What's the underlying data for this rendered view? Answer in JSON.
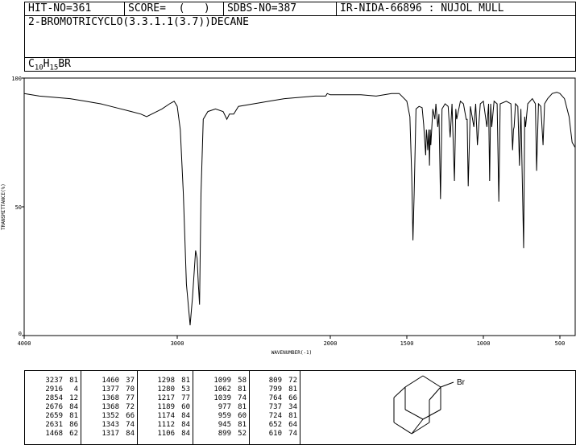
{
  "header": {
    "hit_no": "HIT-NO=361",
    "score": "SCORE=  (   )",
    "sdbs_no": "SDBS-NO=387",
    "ir_id": "IR-NIDA-66896 : NUJOL MULL",
    "compound_name": "2-BROMOTRICYCLO(3.3.1.1(3.7))DECANE",
    "formula_c": "C",
    "formula_c_sub": "10",
    "formula_h": "H",
    "formula_h_sub": "15",
    "formula_br": "BR"
  },
  "structure": {
    "atom_label": "Br"
  },
  "chart_data": {
    "type": "line",
    "xlabel": "WAVENUMBER(-1)",
    "ylabel": "TRANSMITTANCE(%)",
    "xlim": [
      4000,
      400
    ],
    "ylim": [
      0,
      100
    ],
    "x_ticks": [
      4000,
      3000,
      2000,
      1500,
      1000,
      500
    ],
    "y_ticks": [
      0,
      50,
      100
    ],
    "x_tick_labels": [
      "4000",
      "3000",
      "2000",
      "1500",
      "1000",
      "500"
    ],
    "y_tick_labels": [
      "0",
      "50",
      "100"
    ],
    "series": [
      {
        "values": [
          [
            4000,
            94
          ],
          [
            3900,
            93
          ],
          [
            3800,
            92.5
          ],
          [
            3700,
            92
          ],
          [
            3600,
            91
          ],
          [
            3500,
            90
          ],
          [
            3400,
            88.5
          ],
          [
            3300,
            87
          ],
          [
            3237,
            86
          ],
          [
            3200,
            85
          ],
          [
            3150,
            86.5
          ],
          [
            3100,
            88
          ],
          [
            3050,
            90
          ],
          [
            3020,
            91
          ],
          [
            3000,
            89
          ],
          [
            2980,
            80
          ],
          [
            2960,
            55
          ],
          [
            2940,
            20
          ],
          [
            2916,
            4
          ],
          [
            2900,
            15
          ],
          [
            2880,
            33
          ],
          [
            2870,
            30
          ],
          [
            2862,
            20
          ],
          [
            2854,
            12
          ],
          [
            2845,
            55
          ],
          [
            2830,
            84
          ],
          [
            2800,
            87
          ],
          [
            2750,
            88
          ],
          [
            2700,
            87
          ],
          [
            2676,
            84
          ],
          [
            2659,
            86
          ],
          [
            2631,
            86
          ],
          [
            2600,
            89
          ],
          [
            2500,
            90
          ],
          [
            2400,
            91
          ],
          [
            2300,
            92
          ],
          [
            2200,
            92.5
          ],
          [
            2100,
            93
          ],
          [
            2030,
            93
          ],
          [
            2020,
            94
          ],
          [
            2000,
            93.5
          ],
          [
            1900,
            93.5
          ],
          [
            1800,
            93.5
          ],
          [
            1700,
            93
          ],
          [
            1600,
            94
          ],
          [
            1550,
            94
          ],
          [
            1500,
            91
          ],
          [
            1480,
            85
          ],
          [
            1468,
            62
          ],
          [
            1460,
            37
          ],
          [
            1452,
            55
          ],
          [
            1440,
            88
          ],
          [
            1420,
            89
          ],
          [
            1400,
            88.5
          ],
          [
            1390,
            82
          ],
          [
            1377,
            70
          ],
          [
            1372,
            80
          ],
          [
            1368,
            77
          ],
          [
            1363,
            72
          ],
          [
            1356,
            80
          ],
          [
            1352,
            66
          ],
          [
            1347,
            80
          ],
          [
            1343,
            74
          ],
          [
            1330,
            88
          ],
          [
            1317,
            84
          ],
          [
            1310,
            90
          ],
          [
            1298,
            81
          ],
          [
            1290,
            86
          ],
          [
            1280,
            53
          ],
          [
            1270,
            88
          ],
          [
            1250,
            90
          ],
          [
            1230,
            89
          ],
          [
            1217,
            77
          ],
          [
            1205,
            90
          ],
          [
            1189,
            60
          ],
          [
            1180,
            88
          ],
          [
            1174,
            84
          ],
          [
            1150,
            91
          ],
          [
            1130,
            90
          ],
          [
            1112,
            84
          ],
          [
            1106,
            84
          ],
          [
            1099,
            58
          ],
          [
            1085,
            89
          ],
          [
            1062,
            81
          ],
          [
            1050,
            90
          ],
          [
            1039,
            74
          ],
          [
            1020,
            90
          ],
          [
            1000,
            91
          ],
          [
            977,
            81
          ],
          [
            966,
            90
          ],
          [
            959,
            60
          ],
          [
            952,
            90
          ],
          [
            945,
            81
          ],
          [
            930,
            91
          ],
          [
            910,
            90
          ],
          [
            899,
            52
          ],
          [
            890,
            90
          ],
          [
            850,
            91
          ],
          [
            820,
            90
          ],
          [
            809,
            72
          ],
          [
            803,
            80
          ],
          [
            799,
            81
          ],
          [
            790,
            90
          ],
          [
            775,
            89
          ],
          [
            764,
            66
          ],
          [
            755,
            88
          ],
          [
            737,
            34
          ],
          [
            730,
            85
          ],
          [
            724,
            81
          ],
          [
            710,
            90
          ],
          [
            680,
            92
          ],
          [
            660,
            90
          ],
          [
            652,
            64
          ],
          [
            640,
            90
          ],
          [
            625,
            89
          ],
          [
            610,
            74
          ],
          [
            600,
            90
          ],
          [
            580,
            92
          ],
          [
            550,
            94
          ],
          [
            520,
            94.5
          ],
          [
            500,
            94
          ],
          [
            470,
            92
          ],
          [
            440,
            85
          ],
          [
            420,
            75
          ],
          [
            400,
            73
          ]
        ]
      }
    ]
  },
  "peak_table": [
    [
      [
        "3237",
        "81"
      ],
      [
        "2916",
        "4"
      ],
      [
        "2854",
        "12"
      ],
      [
        "2676",
        "84"
      ],
      [
        "2659",
        "81"
      ],
      [
        "2631",
        "86"
      ],
      [
        "1468",
        "62"
      ]
    ],
    [
      [
        "1460",
        "37"
      ],
      [
        "1377",
        "70"
      ],
      [
        "1368",
        "77"
      ],
      [
        "1368",
        "72"
      ],
      [
        "1352",
        "66"
      ],
      [
        "1343",
        "74"
      ],
      [
        "1317",
        "84"
      ]
    ],
    [
      [
        "1298",
        "81"
      ],
      [
        "1280",
        "53"
      ],
      [
        "1217",
        "77"
      ],
      [
        "1189",
        "60"
      ],
      [
        "1174",
        "84"
      ],
      [
        "1112",
        "84"
      ],
      [
        "1106",
        "84"
      ]
    ],
    [
      [
        "1099",
        "58"
      ],
      [
        "1062",
        "81"
      ],
      [
        "1039",
        "74"
      ],
      [
        "977",
        "81"
      ],
      [
        "959",
        "60"
      ],
      [
        "945",
        "81"
      ],
      [
        "899",
        "52"
      ]
    ],
    [
      [
        "809",
        "72"
      ],
      [
        "799",
        "81"
      ],
      [
        "764",
        "66"
      ],
      [
        "737",
        "34"
      ],
      [
        "724",
        "81"
      ],
      [
        "652",
        "64"
      ],
      [
        "610",
        "74"
      ]
    ]
  ]
}
